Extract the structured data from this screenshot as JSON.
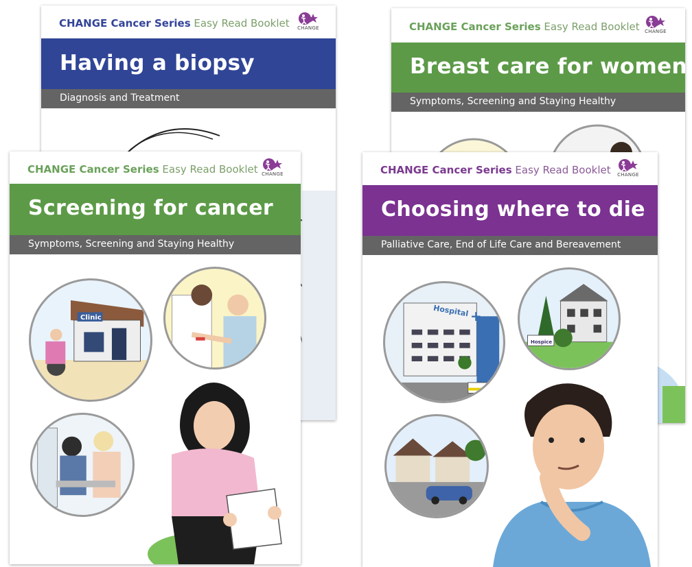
{
  "series": {
    "brand": "CHANGE Cancer Series",
    "rest": "Easy Read Booklet",
    "logo_text": "CHANGE"
  },
  "booklets": [
    {
      "title": "Having a biopsy",
      "subtitle": "Diagnosis and Treatment",
      "brand_color": "#33449a",
      "band_color": "#304596"
    },
    {
      "title": "Breast care for women",
      "subtitle": "Symptoms, Screening and Staying Healthy",
      "brand_color": "#6aa15a",
      "band_color": "#5c9a47"
    },
    {
      "title": "Screening for cancer",
      "subtitle": "Symptoms, Screening and Staying Healthy",
      "brand_color": "#6aa15a",
      "band_color": "#5c9a47",
      "clinic_sign": "Clinic"
    },
    {
      "title": "Choosing where to die",
      "subtitle": "Palliative Care, End of Life Care and Bereavement",
      "brand_color": "#7a3a8f",
      "band_color": "#7b3291",
      "hospital_sign": "Hospital",
      "hospice_sign": "Hospice"
    }
  ],
  "colors": {
    "logo_purple": "#8a3c96",
    "subtitle_grey": "#646464"
  }
}
